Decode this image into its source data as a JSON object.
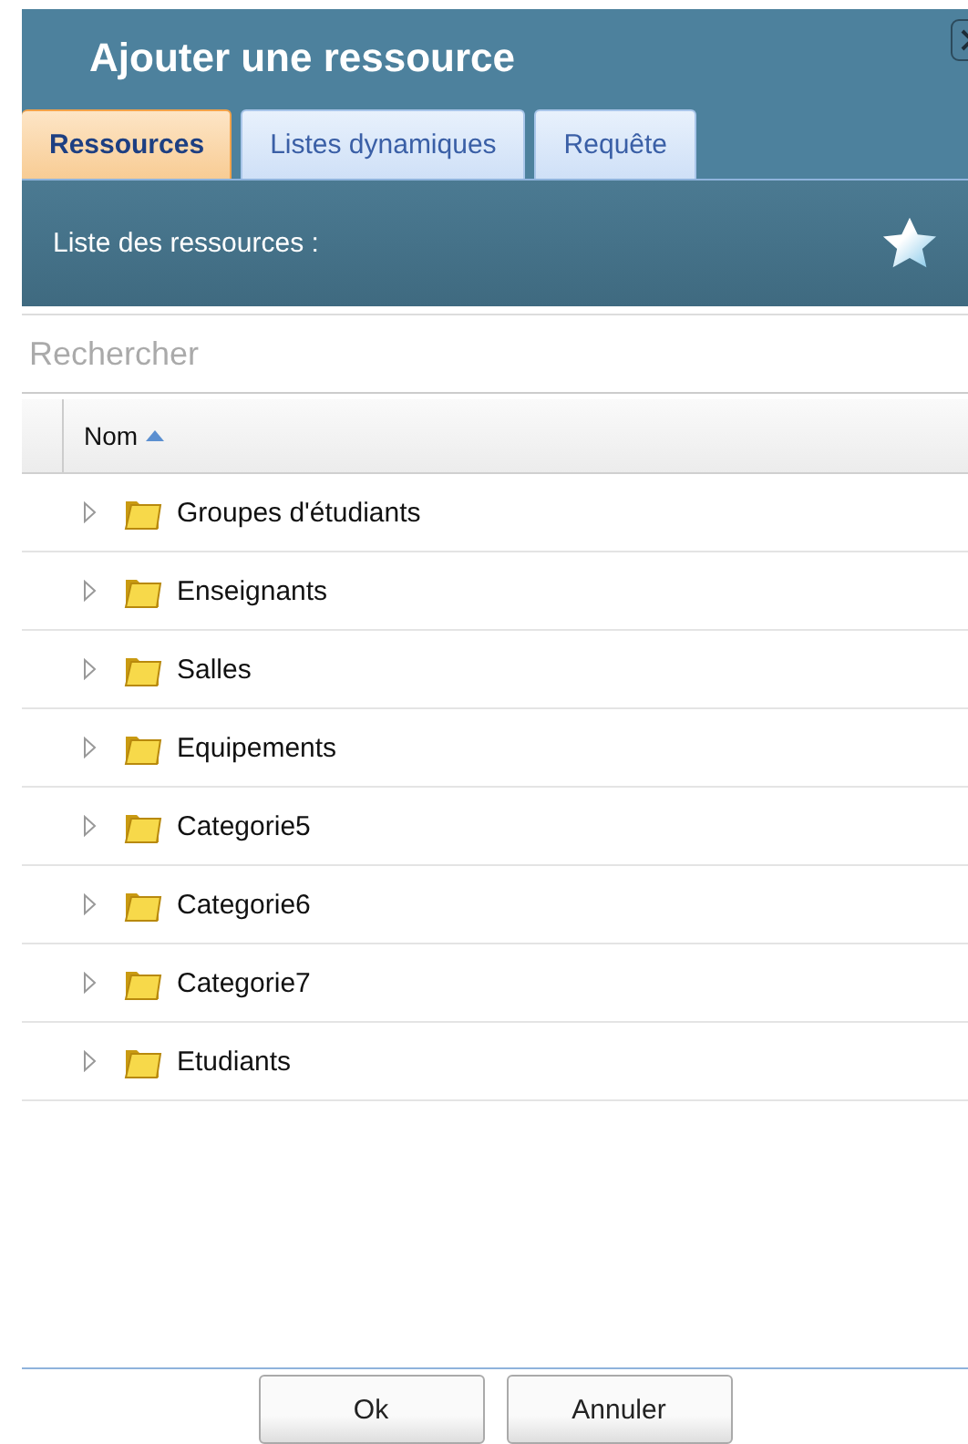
{
  "window": {
    "title": "Ajouter une ressource"
  },
  "tabs": [
    {
      "label": "Ressources",
      "selected": true
    },
    {
      "label": "Listes dynamiques",
      "selected": false
    },
    {
      "label": "Requête",
      "selected": false
    }
  ],
  "panel": {
    "title": "Liste des ressources :"
  },
  "search": {
    "placeholder": "Rechercher"
  },
  "table": {
    "columns": [
      {
        "label": "Nom",
        "sorted_ascending": true
      }
    ],
    "rows": [
      {
        "name": "Groupes d'étudiants",
        "expanded": false
      },
      {
        "name": "Enseignants",
        "expanded": false
      },
      {
        "name": "Salles",
        "expanded": false
      },
      {
        "name": "Equipements",
        "expanded": false
      },
      {
        "name": "Categorie5",
        "expanded": false
      },
      {
        "name": "Categorie6",
        "expanded": false
      },
      {
        "name": "Categorie7",
        "expanded": false
      },
      {
        "name": "Etudiants",
        "expanded": false
      }
    ]
  },
  "buttons": [
    "Ok",
    "Annuler"
  ]
}
